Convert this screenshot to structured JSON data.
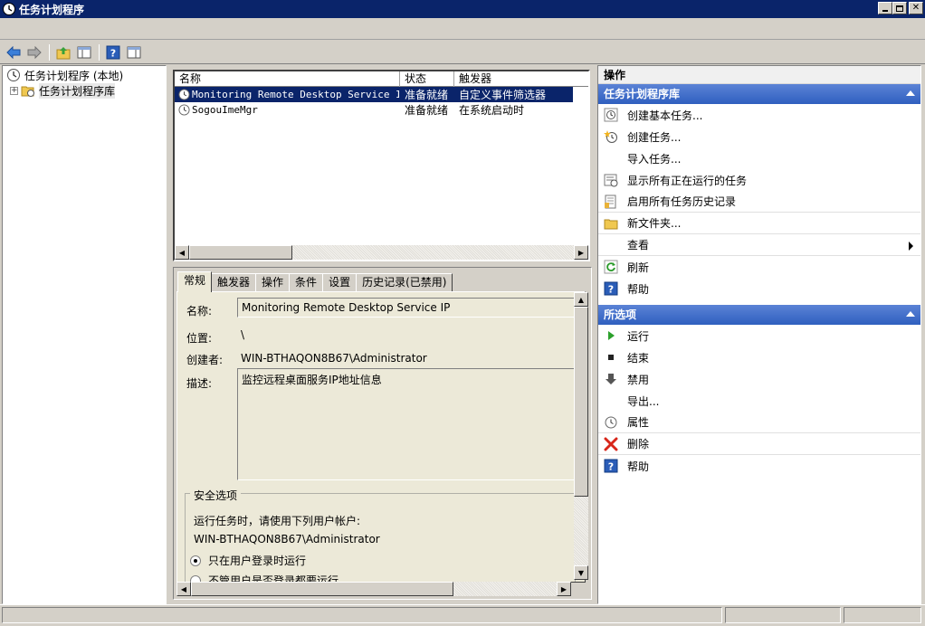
{
  "window": {
    "title": "任务计划程序"
  },
  "tree": {
    "root": "任务计划程序 (本地)",
    "child": "任务计划程序库",
    "expander": "+"
  },
  "list": {
    "columns": [
      "名称",
      "状态",
      "触发器"
    ],
    "rows": [
      {
        "name": "Monitoring Remote Desktop Service IP",
        "status": "准备就绪",
        "trigger": "自定义事件筛选器",
        "selected": true
      },
      {
        "name": "SogouImeMgr",
        "status": "准备就绪",
        "trigger": "在系统启动时",
        "selected": false
      }
    ]
  },
  "details": {
    "tabs": [
      "常规",
      "触发器",
      "操作",
      "条件",
      "设置",
      "历史记录(已禁用)"
    ],
    "labels": {
      "name": "名称:",
      "location": "位置:",
      "author": "创建者:",
      "description": "描述:"
    },
    "values": {
      "name": "Monitoring Remote Desktop Service IP",
      "location": "\\",
      "author": "WIN-BTHAQON8B67\\Administrator",
      "description": "监控远程桌面服务IP地址信息"
    },
    "security": {
      "title": "安全选项",
      "prompt": "运行任务时，请使用下列用户帐户:",
      "account": "WIN-BTHAQON8B67\\Administrator",
      "option1": "只在用户登录时运行",
      "option2": "不管用户是否登录都要运行"
    }
  },
  "actions": {
    "header": "操作",
    "section1": {
      "title": "任务计划程序库",
      "items": [
        "创建基本任务...",
        "创建任务...",
        "导入任务...",
        "显示所有正在运行的任务",
        "启用所有任务历史记录",
        "新文件夹...",
        "查看",
        "刷新",
        "帮助"
      ]
    },
    "section2": {
      "title": "所选项",
      "items": [
        "运行",
        "结束",
        "禁用",
        "导出...",
        "属性",
        "删除",
        "帮助"
      ]
    }
  },
  "colors": {
    "titlebar": "#0a246a",
    "section": "#3a67c6",
    "selection": "#0a246a"
  }
}
